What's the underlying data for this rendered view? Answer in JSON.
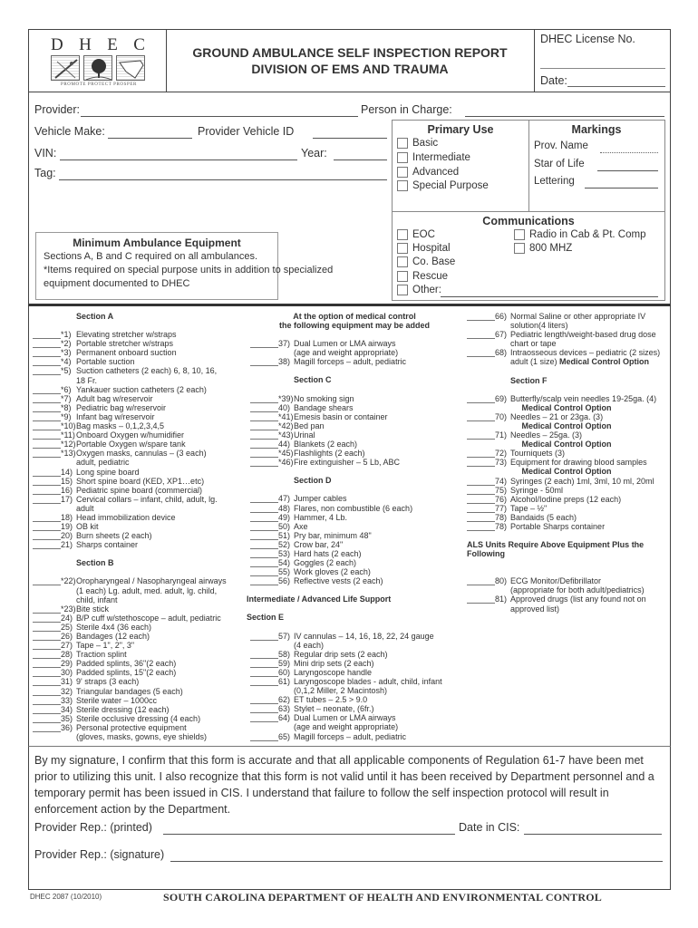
{
  "header": {
    "logo": {
      "letters": [
        "D",
        "H",
        "E",
        "C"
      ],
      "motto": "PROMOTE PROTECT PROSPER"
    },
    "title_line1": "GROUND AMBULANCE SELF INSPECTION REPORT",
    "title_line2": "DIVISION OF EMS AND TRAUMA",
    "license_label": "DHEC License No.",
    "license_value": "",
    "date_label": "Date:",
    "date_value": ""
  },
  "form": {
    "provider_label": "Provider:",
    "provider_value": "",
    "person_in_charge_label": "Person in Charge:",
    "person_in_charge_value": "",
    "vehicle_make_label": "Vehicle Make:",
    "vehicle_make_value": "",
    "provider_vehicle_id_label": "Provider Vehicle ID",
    "provider_vehicle_id_value": "",
    "vin_label": "VIN:",
    "vin_value": "",
    "year_label": "Year:",
    "year_value": "",
    "tag_label": "Tag:",
    "tag_value": ""
  },
  "primary_use": {
    "title": "Primary Use",
    "options": [
      {
        "label": "Basic",
        "checked": false
      },
      {
        "label": "Intermediate",
        "checked": false
      },
      {
        "label": "Advanced",
        "checked": false
      },
      {
        "label": "Special Purpose",
        "checked": false
      }
    ]
  },
  "markings": {
    "title": "Markings",
    "fields": [
      {
        "label": "Prov. Name",
        "value": ""
      },
      {
        "label": "Star of Life",
        "value": ""
      },
      {
        "label": "Lettering",
        "value": ""
      }
    ]
  },
  "communications": {
    "title": "Communications",
    "left_options": [
      {
        "label": "EOC",
        "checked": false
      },
      {
        "label": "Hospital",
        "checked": false
      },
      {
        "label": "Co. Base",
        "checked": false
      },
      {
        "label": "Rescue",
        "checked": false
      },
      {
        "label": "Other:",
        "checked": false
      }
    ],
    "right_options": [
      {
        "label": "Radio in Cab & Pt. Comp",
        "checked": false
      },
      {
        "label": "800 MHZ",
        "checked": false
      }
    ],
    "other_value": ""
  },
  "minimum_equipment": {
    "title": "Minimum Ambulance Equipment",
    "lines": [
      "Sections A, B and C required on all ambulances.",
      "*Items required on special purpose units in addition to specialized",
      "equipment documented to DHEC"
    ]
  },
  "equipment": {
    "col1": {
      "section_a": "Section A",
      "section_a_items": [
        {
          "num": "*1)",
          "text": "Elevating stretcher w/straps"
        },
        {
          "num": "*2)",
          "text": "Portable stretcher w/straps"
        },
        {
          "num": "*3)",
          "text": "Permanent onboard suction"
        },
        {
          "num": "*4)",
          "text": "Portable suction"
        },
        {
          "num": "*5)",
          "text": "Suction catheters (2 each) 6, 8, 10, 16,",
          "cont": "18 Fr."
        },
        {
          "num": "*6)",
          "text": "Yankauer suction catheters (2 each)"
        },
        {
          "num": "*7)",
          "text": "Adult bag w/reservoir"
        },
        {
          "num": "*8)",
          "text": "Pediatric bag w/reservoir"
        },
        {
          "num": "*9)",
          "text": "Infant bag w/reservoir"
        },
        {
          "num": "*10)",
          "text": "Bag masks – 0,1,2,3,4,5"
        },
        {
          "num": "*11)",
          "text": "Onboard Oxygen w/humidifier"
        },
        {
          "num": "*12)",
          "text": "Portable Oxygen w/spare tank"
        },
        {
          "num": "*13)",
          "text": "Oxygen masks, cannulas – (3 each)",
          "cont": "adult, pediatric"
        },
        {
          "num": "14)",
          "text": "Long spine board"
        },
        {
          "num": "15)",
          "text": "Short spine board (KED, XP1…etc)"
        },
        {
          "num": "16)",
          "text": "Pediatric spine board (commercial)"
        },
        {
          "num": "17)",
          "text": "Cervical collars – infant, child, adult, lg.",
          "cont": "adult"
        },
        {
          "num": "18)",
          "text": "Head immobilization device"
        },
        {
          "num": "19)",
          "text": "OB kit"
        },
        {
          "num": "20)",
          "text": "Burn sheets (2 each)"
        },
        {
          "num": "21)",
          "text": "Sharps container"
        }
      ],
      "section_b": "Section B",
      "section_b_items": [
        {
          "num": "*22)",
          "text": "Oropharyngeal / Nasopharyngeal airways",
          "cont": "(1 each) Lg. adult, med. adult, lg. child,",
          "cont2": "child, infant"
        },
        {
          "num": "*23)",
          "text": "Bite stick"
        },
        {
          "num": "24)",
          "text": "B/P cuff w/stethoscope – adult, pediatric"
        },
        {
          "num": "25)",
          "text": "Sterile 4x4 (36 each)"
        },
        {
          "num": "26)",
          "text": "Bandages (12 each)"
        },
        {
          "num": "27)",
          "text": "Tape – 1\", 2\", 3\""
        },
        {
          "num": "28)",
          "text": "Traction splint"
        },
        {
          "num": "29)",
          "text": "Padded splints, 36\"(2 each)"
        },
        {
          "num": "30)",
          "text": "Padded splints, 15\"(2 each)"
        },
        {
          "num": "31)",
          "text": "9' straps (3 each)"
        },
        {
          "num": "32)",
          "text": "Triangular bandages (5 each)"
        },
        {
          "num": "33)",
          "text": "Sterile water – 1000cc"
        },
        {
          "num": "34)",
          "text": "Sterile dressing (12 each)"
        },
        {
          "num": "35)",
          "text": "Sterile occlusive dressing (4 each)"
        },
        {
          "num": "36)",
          "text": "Personal protective equipment",
          "cont": "(gloves, masks, gowns, eye shields)"
        }
      ]
    },
    "col2": {
      "option_header_line1": "At the option of medical control",
      "option_header_line2": "the following equipment may be added",
      "option_items": [
        {
          "num": "37)",
          "text": "Dual Lumen or LMA airways",
          "cont": "(age and weight appropriate)"
        },
        {
          "num": "38)",
          "text": "Magill forceps – adult, pediatric"
        }
      ],
      "section_c": "Section C",
      "section_c_items": [
        {
          "num": "*39)",
          "text": "No smoking sign"
        },
        {
          "num": "40)",
          "text": "Bandage shears"
        },
        {
          "num": "*41)",
          "text": "Emesis basin or container"
        },
        {
          "num": "*42)",
          "text": "Bed pan"
        },
        {
          "num": "*43)",
          "text": "Urinal"
        },
        {
          "num": "44)",
          "text": "Blankets (2 each)"
        },
        {
          "num": "*45)",
          "text": "Flashlights (2 each)"
        },
        {
          "num": "*46)",
          "text": "Fire extinguisher – 5 Lb, ABC"
        }
      ],
      "section_d": "Section D",
      "section_d_items": [
        {
          "num": "47)",
          "text": "Jumper cables"
        },
        {
          "num": "48)",
          "text": "Flares, non combustible (6 each)"
        },
        {
          "num": "49)",
          "text": "Hammer, 4 Lb."
        },
        {
          "num": "50)",
          "text": "Axe"
        },
        {
          "num": "51)",
          "text": "Pry bar, minimum 48\""
        },
        {
          "num": "52)",
          "text": "Crow bar, 24\""
        },
        {
          "num": "53)",
          "text": "Hard hats (2 each)"
        },
        {
          "num": "54)",
          "text": "Goggles (2 each)"
        },
        {
          "num": "55)",
          "text": "Work gloves (2 each)"
        },
        {
          "num": "56)",
          "text": "Reflective vests (2 each)"
        }
      ],
      "ils_header": "Intermediate / Advanced Life Support",
      "section_e": "Section E",
      "section_e_items": [
        {
          "num": "57)",
          "text": "IV cannulas – 14, 16, 18, 22, 24 gauge",
          "cont": "(4 each)"
        },
        {
          "num": "58)",
          "text": "Regular drip sets (2 each)"
        },
        {
          "num": "59)",
          "text": "Mini drip sets (2 each)"
        },
        {
          "num": "60)",
          "text": "Laryngoscope handle"
        },
        {
          "num": "61)",
          "text": "Laryngoscope blades - adult, child, infant",
          "cont": "(0,1,2 Miller, 2 Macintosh)"
        },
        {
          "num": "62)",
          "text": "ET tubes – 2.5 > 9.0"
        },
        {
          "num": "63)",
          "text": "Stylet – neonate, (6fr.)"
        },
        {
          "num": "64)",
          "text": "Dual Lumen or LMA airways",
          "cont": "(age and weight appropriate)"
        },
        {
          "num": "65)",
          "text": "Magill forceps – adult, pediatric"
        }
      ]
    },
    "col3": {
      "top_items": [
        {
          "num": "66)",
          "text": "Normal Saline or other appropriate IV",
          "cont": "solution(4 liters)"
        },
        {
          "num": "67)",
          "text": "Pediatric length/weight-based drug dose",
          "cont": "chart or tape"
        },
        {
          "num": "68)",
          "text": "Intraosseous devices – pediatric (2 sizes)",
          "cont": "adult (1 size)",
          "cont_bold": "Medical Control Option"
        }
      ],
      "section_f": "Section F",
      "medical_control_option": "Medical Control Option",
      "section_f_items": [
        {
          "num": "69)",
          "text": "Butterfly/scalp vein needles 19-25ga. (4)",
          "mco": true
        },
        {
          "num": "70)",
          "text": "Needles – 21 or 23ga. (3)",
          "mco": true
        },
        {
          "num": "71)",
          "text": "Needles – 25ga. (3)",
          "mco": true
        },
        {
          "num": "72)",
          "text": "Tourniquets (3)"
        },
        {
          "num": "73)",
          "text": "Equipment for drawing blood samples",
          "mco": true
        },
        {
          "num": "74)",
          "text": "Syringes (2 each) 1ml, 3ml, 10 ml, 20ml"
        },
        {
          "num": "75)",
          "text": "Syringe - 50ml"
        },
        {
          "num": "76)",
          "text": "Alcohol/Iodine preps (12 each)"
        },
        {
          "num": "77)",
          "text": "Tape – ½\""
        },
        {
          "num": "78)",
          "text": "Bandaids (5 each)"
        },
        {
          "num": "78)",
          "text": "Portable Sharps container"
        }
      ],
      "als_header": "ALS Units Require Above Equipment Plus the Following",
      "als_items": [
        {
          "num": "80)",
          "text": "ECG Monitor/Defibrillator",
          "cont": "(appropriate for both adult/pediatrics)"
        },
        {
          "num": "81)",
          "text": "Approved drugs (list any found not on",
          "cont": "approved list)"
        }
      ]
    }
  },
  "signature": {
    "statement": "By my signature, I confirm that this form is accurate and that all applicable components of Regulation 61-7 have been met prior to utilizing this unit. I also recognize that this form is not valid until it has been received by Department personnel and a temporary permit has been issued in CIS. I understand that failure to follow the self inspection protocol will result in enforcement action by the Department.",
    "printed_label": "Provider Rep.: (printed)",
    "printed_value": "",
    "date_cis_label": "Date in CIS:",
    "date_cis_value": "",
    "signature_label": "Provider Rep.: (signature)",
    "signature_value": ""
  },
  "footer": {
    "form_code": "DHEC 2087 (10/2010)",
    "department": "SOUTH CAROLINA DEPARTMENT OF HEALTH AND ENVIRONMENTAL CONTROL"
  }
}
